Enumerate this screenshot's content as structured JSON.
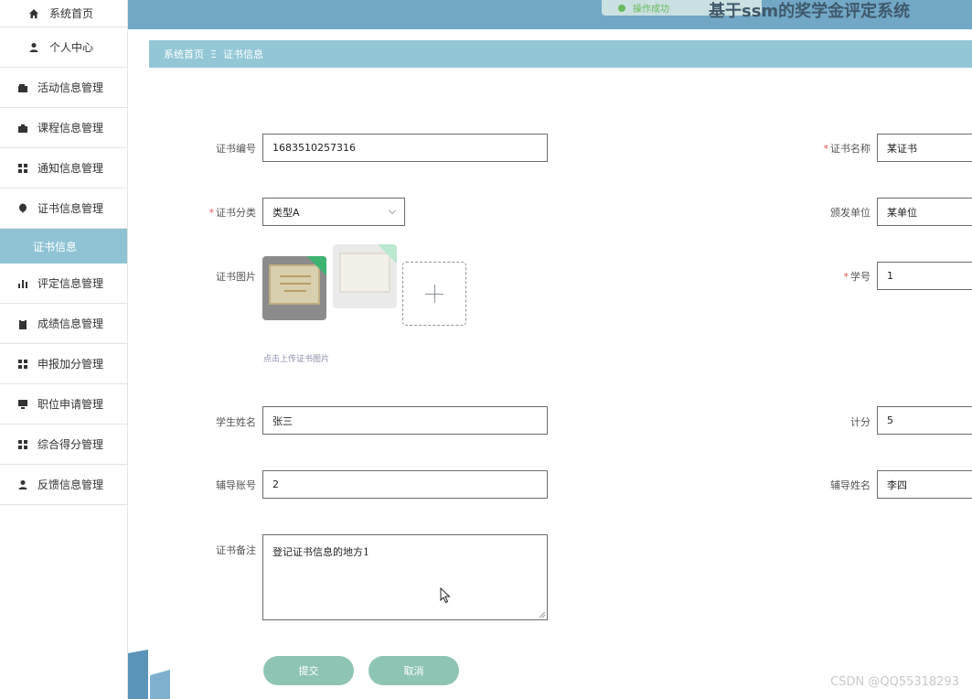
{
  "app": {
    "title": "基于ssm的奖学金评定系统",
    "toast": "操作成功"
  },
  "sidebar": {
    "items": [
      {
        "label": "系统首页",
        "icon": "home-icon"
      },
      {
        "label": "个人中心",
        "icon": "user-icon"
      },
      {
        "label": "活动信息管理",
        "icon": "wallet-icon"
      },
      {
        "label": "课程信息管理",
        "icon": "briefcase-icon"
      },
      {
        "label": "通知信息管理",
        "icon": "grid-icon"
      },
      {
        "label": "证书信息管理",
        "icon": "balloon-icon"
      },
      {
        "label": "证书信息",
        "icon": ""
      },
      {
        "label": "评定信息管理",
        "icon": "bar-chart-icon"
      },
      {
        "label": "成绩信息管理",
        "icon": "clipboard-icon"
      },
      {
        "label": "申报加分管理",
        "icon": "grid-icon"
      },
      {
        "label": "职位申请管理",
        "icon": "monitor-icon"
      },
      {
        "label": "综合得分管理",
        "icon": "grid-icon"
      },
      {
        "label": "反馈信息管理",
        "icon": "user-icon"
      }
    ]
  },
  "breadcrumb": {
    "home": "系统首页",
    "separator": "Ξ",
    "current": "证书信息"
  },
  "form": {
    "cert_no": {
      "label": "证书编号",
      "value": "1683510257316"
    },
    "cert_name": {
      "label": "证书名称",
      "value": "某证书",
      "required_mark": "*"
    },
    "cert_type": {
      "label": "证书分类",
      "value": "类型A",
      "required_mark": "*"
    },
    "issuer": {
      "label": "颁发单位",
      "value": "某单位"
    },
    "cert_image": {
      "label": "证书图片",
      "hint": "点击上传证书图片"
    },
    "student_id": {
      "label": "学号",
      "value": "1",
      "required_mark": "*"
    },
    "student_name": {
      "label": "学生姓名",
      "value": "张三"
    },
    "points": {
      "label": "计分",
      "value": "5"
    },
    "tutor_account": {
      "label": "辅导账号",
      "value": "2"
    },
    "tutor_name": {
      "label": "辅导姓名",
      "value": "李四"
    },
    "remark": {
      "label": "证书备注",
      "value": "登记证书信息的地方1"
    },
    "submit_label": "提交",
    "cancel_label": "取消"
  },
  "watermark": "CSDN @QQ55318293",
  "colors": {
    "topbar": "#72a7c6",
    "breadcrumb": "#93c7d6",
    "sidebar_active": "#8fc3d4",
    "button": "#8ec4b4",
    "required": "#e45656"
  }
}
